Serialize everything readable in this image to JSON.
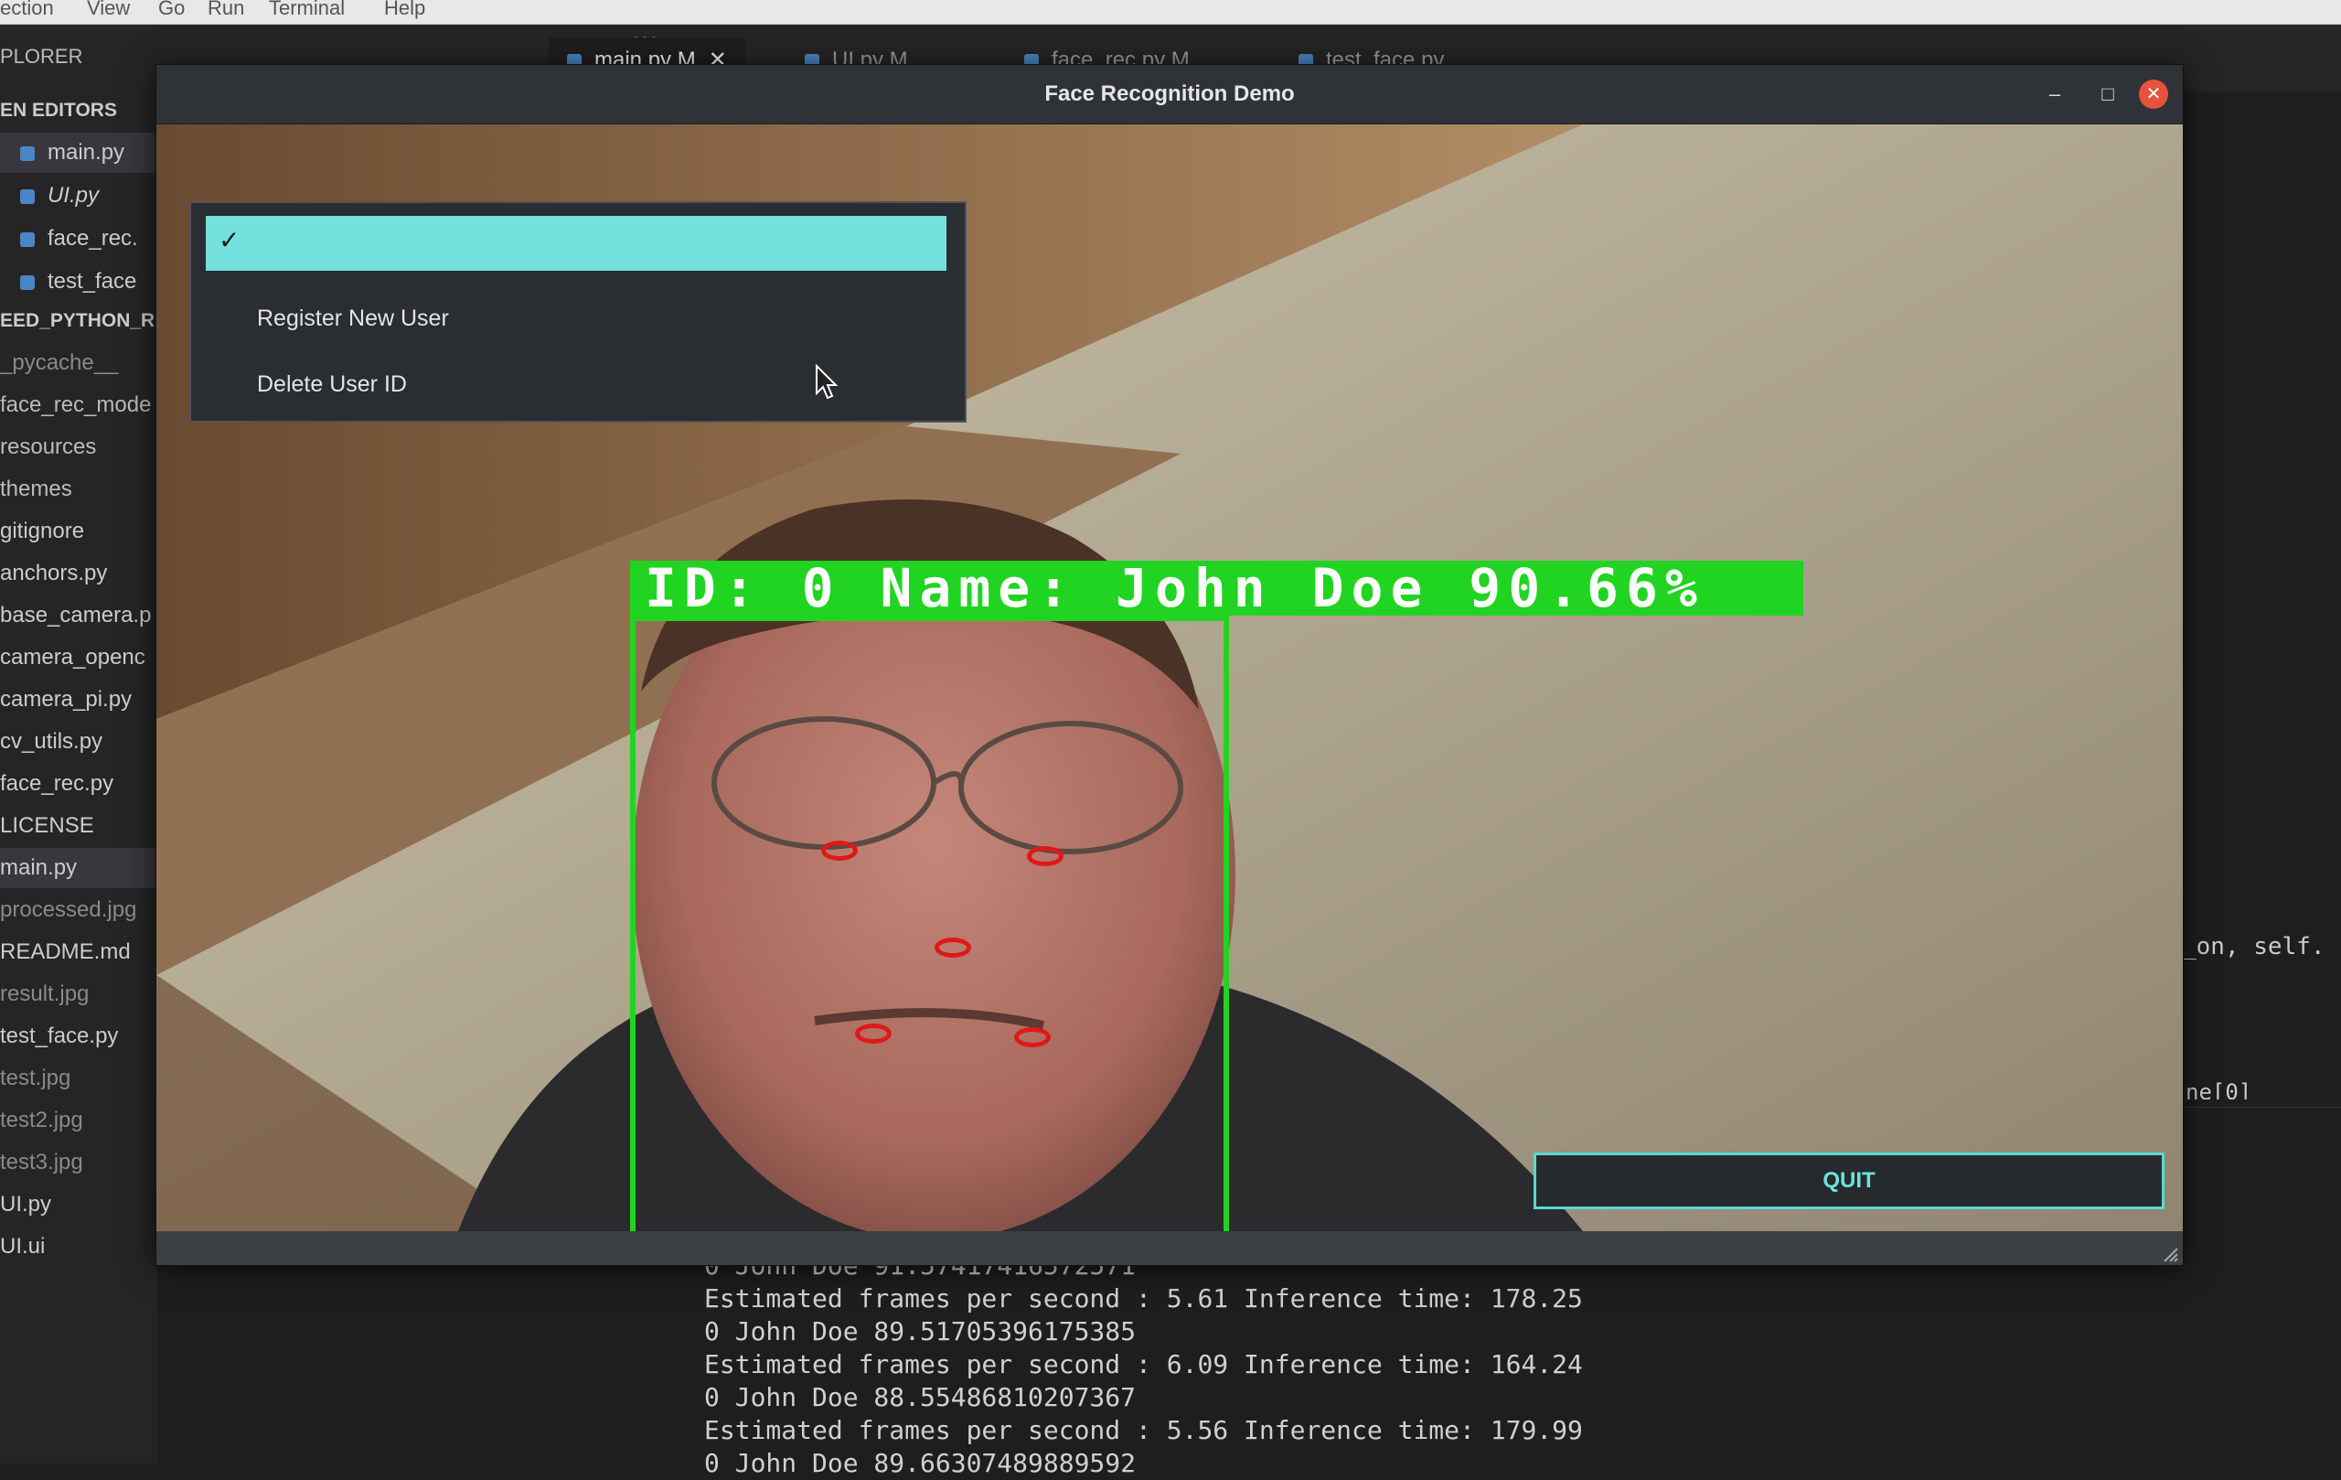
{
  "vscode": {
    "menubar": [
      "ection",
      "View",
      "Go",
      "Run",
      "Terminal",
      "Help"
    ],
    "explorer_title": "PLORER",
    "open_editors_title": "EN EDITORS",
    "open_editors": [
      {
        "label": "main.py",
        "italic": false
      },
      {
        "label": "UI.py",
        "italic": true
      },
      {
        "label": "face_rec.",
        "italic": false
      },
      {
        "label": "test_face",
        "italic": false
      }
    ],
    "project_title": "EED_PYTHON_R",
    "files": [
      {
        "label": "_pycache__",
        "style": "dim"
      },
      {
        "label": "face_rec_mode",
        "style": "folder"
      },
      {
        "label": "resources",
        "style": "folder"
      },
      {
        "label": "themes",
        "style": "folder"
      },
      {
        "label": "gitignore",
        "style": "normal"
      },
      {
        "label": "anchors.py",
        "style": "normal"
      },
      {
        "label": "base_camera.p",
        "style": "normal"
      },
      {
        "label": "camera_openc",
        "style": "normal"
      },
      {
        "label": "camera_pi.py",
        "style": "normal"
      },
      {
        "label": "cv_utils.py",
        "style": "normal"
      },
      {
        "label": "face_rec.py",
        "style": "normal"
      },
      {
        "label": "LICENSE",
        "style": "normal"
      },
      {
        "label": "main.py",
        "style": "active"
      },
      {
        "label": "processed.jpg",
        "style": "dim"
      },
      {
        "label": "README.md",
        "style": "normal"
      },
      {
        "label": "result.jpg",
        "style": "dim"
      },
      {
        "label": "test_face.py",
        "style": "normal"
      },
      {
        "label": "test.jpg",
        "style": "dim"
      },
      {
        "label": "test2.jpg",
        "style": "dim"
      },
      {
        "label": "test3.jpg",
        "style": "dim"
      },
      {
        "label": "UI.py",
        "style": "normal"
      },
      {
        "label": "UI.ui",
        "style": "normal"
      }
    ],
    "tabs": [
      {
        "label": "main.py  M",
        "close": "✕"
      },
      {
        "label": "UI.py  M",
        "close": ""
      },
      {
        "label": "face_rec.py  M",
        "close": ""
      },
      {
        "label": "test_face.py",
        "close": ""
      }
    ],
    "more_icon": "⋯",
    "editor_snippet": "_on, self.",
    "editor_snippet_self": "self.",
    "editor_snippet2": "ne[0]",
    "terminal_lines": [
      "0 John Doe 91.57417416572571",
      "Estimated frames per second : 5.61 Inference time: 178.25",
      "0 John Doe 89.51705396175385",
      "Estimated frames per second : 6.09 Inference time: 164.24",
      "0 John Doe 88.55486810207367",
      "Estimated frames per second : 5.56 Inference time: 179.99",
      "0 John Doe 89.66307489889592"
    ]
  },
  "dialog": {
    "title": "Face Recognition Demo",
    "minimize_icon": "–",
    "maximize_icon": "□",
    "close_icon": "✕",
    "menu": {
      "check": "✓",
      "selected_label": "",
      "items": [
        "Register New User",
        "Delete User ID"
      ]
    },
    "detection_label": "ID: 0 Name: John Doe 90.66%",
    "quit_label": "QUIT",
    "colors": {
      "accent": "#74e0dc",
      "detection_green": "#22d422",
      "landmark_red": "#e01818",
      "close_button": "#e8513b"
    }
  }
}
